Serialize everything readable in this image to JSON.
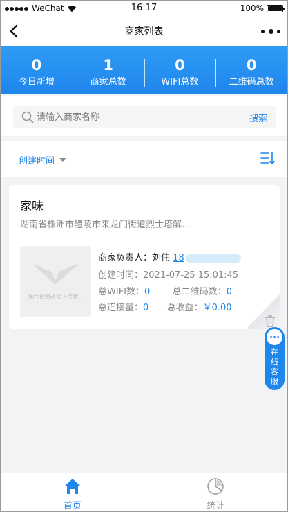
{
  "status_bar": {
    "carrier": "WeChat",
    "time": "16:17",
    "battery": "100%",
    "battery_level": 1.0
  },
  "navbar": {
    "title": "商家列表"
  },
  "stats": [
    {
      "value": "0",
      "label": "今日新增"
    },
    {
      "value": "1",
      "label": "商家总数"
    },
    {
      "value": "0",
      "label": "WIFI总数"
    },
    {
      "value": "0",
      "label": "二维码总数"
    }
  ],
  "search": {
    "placeholder": "请输入商家名称",
    "button": "搜索"
  },
  "sort": {
    "label": "创建时间"
  },
  "merchant": {
    "name": "家味",
    "address": "湖南省株洲市醴陵市来龙门街道烈士塔解...",
    "image_caption": "图片暂时还没上传哦~",
    "manager_label": "商家负责人：",
    "manager_name": "刘伟",
    "phone_visible": "18",
    "created_label": "创建时间：",
    "created_value": "2021-07-25 15:01:45",
    "wifi_label": "总WIFI数：",
    "wifi_value": "0",
    "qr_label": "总二维码数：",
    "qr_value": "0",
    "connections_label": "总连接量：",
    "connections_value": "0",
    "income_label": "总收益：",
    "income_value": "￥0.00"
  },
  "customer_service": {
    "label": "在线客服",
    "chars": [
      "在",
      "线",
      "客",
      "服"
    ]
  },
  "tabbar": [
    {
      "label": "首页",
      "active": true
    },
    {
      "label": "统计",
      "active": false
    }
  ],
  "colors": {
    "accent": "#1f86ec",
    "header_gradient_top": "#2f9bf5",
    "background": "#f2f3f5"
  }
}
